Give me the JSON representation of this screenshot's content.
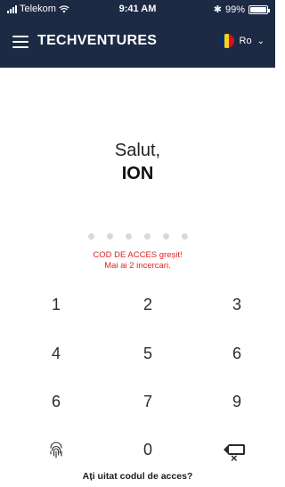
{
  "status_bar": {
    "carrier": "Telekom",
    "time": "9:41 AM",
    "bluetooth": "✱",
    "battery": "99%",
    "battery_level": 0.99
  },
  "header": {
    "brand": "TECHVENTURES",
    "language": "Ro",
    "icons": [
      "hamburger-icon",
      "wifi-icon",
      "bluetooth-icon",
      "battery-icon",
      "flag-ro-icon",
      "chevron-down-icon"
    ],
    "colors": {
      "bar": "#1d2a44",
      "flag": [
        "#002b7f",
        "#fcd116",
        "#ce1126"
      ]
    }
  },
  "greeting": {
    "hello": "Salut,",
    "name": "ION"
  },
  "passcode": {
    "length": 6,
    "filled": 0,
    "error_line1": "COD DE ACCES greșit!",
    "error_line2": "Mai ai 2 incercari.",
    "error_color": "#e02424"
  },
  "keypad": {
    "keys": [
      "1",
      "2",
      "3",
      "4",
      "5",
      "6",
      "6",
      "7",
      "9",
      "0"
    ],
    "icons": [
      "fingerprint-icon",
      "backspace-icon"
    ]
  },
  "footer": {
    "forgot": "Ați uitat codul de acces?"
  }
}
